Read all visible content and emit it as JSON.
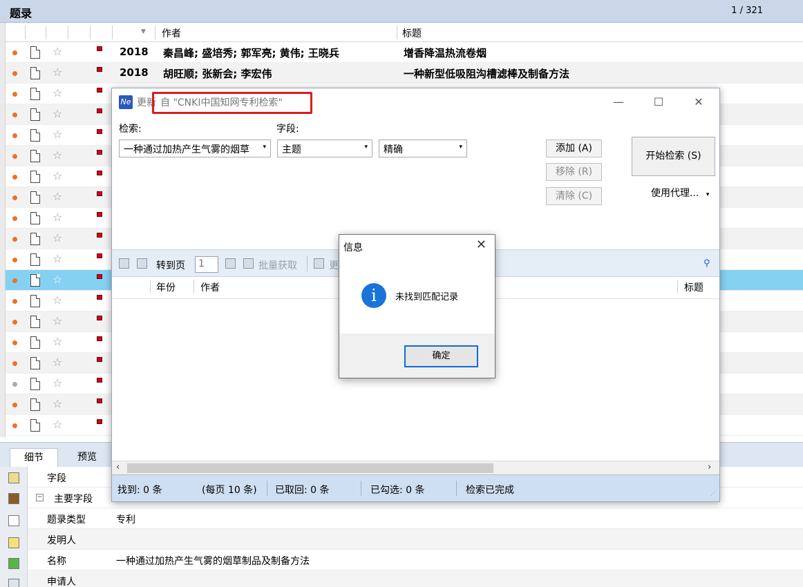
{
  "main": {
    "title": "题录",
    "page_count": "1 / 321",
    "columns": {
      "author": "作者",
      "title": "标题"
    },
    "rows": [
      {
        "year": "2018",
        "author": "秦昌峰; 盛培秀; 郭军亮; 黄伟; 王晓兵",
        "title": "增香降温热流卷烟"
      },
      {
        "year": "2018",
        "author": "胡旺顺; 张新会; 李宏伟",
        "title": "一种新型低吸阻沟槽滤棒及制备方法"
      }
    ]
  },
  "detail": {
    "tabs": [
      "细节",
      "预览"
    ],
    "field_header": "字段",
    "group": "主要字段",
    "fields": [
      {
        "name": "题录类型",
        "value": "专利"
      },
      {
        "name": "发明人",
        "value": ""
      },
      {
        "name": "名称",
        "value": "一种通过加热产生气雾的烟草制品及制备方法"
      },
      {
        "name": "申请人",
        "value": ""
      }
    ]
  },
  "dialog": {
    "title_prefix": "更新",
    "title_source": "自 \"CNKI中国知网专利检索\"",
    "search_label": "检索:",
    "field_label": "字段:",
    "search_value": "一种通过加热产生气雾的烟草",
    "field_value": "主题",
    "match_value": "精确",
    "add_button": "添加 (A)",
    "remove_button": "移除 (R)",
    "clear_button": "清除 (C)",
    "start_button": "开始检索 (S)",
    "proxy_label": "使用代理...",
    "toolbar": {
      "goto_label": "转到页",
      "page_value": "1",
      "batch_label": "批量获取",
      "more_label": "更"
    },
    "result_columns": {
      "year": "年份",
      "author": "作者",
      "title": "标题"
    },
    "status": {
      "found": "找到: 0 条",
      "per_page": "(每页 10 条)",
      "fetched": "已取回: 0 条",
      "checked": "已勾选: 0 条",
      "state": "检索已完成"
    }
  },
  "message_box": {
    "title": "信息",
    "text": "未找到匹配记录",
    "ok_button": "确定",
    "close_glyph": "✕",
    "icon_glyph": "i"
  },
  "icons": {
    "logo_glyph": "Ne",
    "star_glyph": "☆",
    "minimize_glyph": "—",
    "maximize_glyph": "☐",
    "close_glyph": "✕",
    "dropdown_glyph": "▾",
    "sort_glyph": "▼"
  }
}
